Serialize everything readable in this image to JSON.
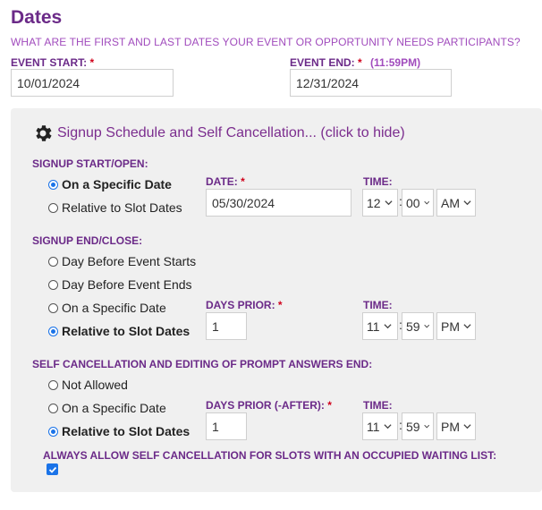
{
  "header": {
    "title": "Dates",
    "question": "WHAT ARE THE FIRST AND LAST DATES YOUR EVENT OR OPPORTUNITY NEEDS PARTICIPANTS?"
  },
  "event_start": {
    "label": "EVENT START:",
    "required": "*",
    "value": "10/01/2024"
  },
  "event_end": {
    "label": "EVENT END:",
    "required": "*",
    "hint": "(11:59PM)",
    "value": "12/31/2024"
  },
  "panel": {
    "title": "Signup Schedule and Self Cancellation... (click to hide)",
    "signup_start": {
      "heading": "SIGNUP START/OPEN:",
      "options": [
        "On a Specific Date",
        "Relative to Slot Dates"
      ],
      "selected": "On a Specific Date",
      "date_label": "DATE:",
      "date_required": "*",
      "date_value": "05/30/2024",
      "time_label": "TIME:",
      "hour": "12",
      "minute": "00",
      "ampm": "AM"
    },
    "signup_end": {
      "heading": "SIGNUP END/CLOSE:",
      "options": [
        "Day Before Event Starts",
        "Day Before Event Ends",
        "On a Specific Date",
        "Relative to Slot Dates"
      ],
      "selected": "Relative to Slot Dates",
      "days_label": "DAYS PRIOR:",
      "days_required": "*",
      "days_value": "1",
      "time_label": "TIME:",
      "hour": "11",
      "minute": "59",
      "ampm": "PM"
    },
    "self_cancel": {
      "heading": "SELF CANCELLATION AND EDITING OF PROMPT ANSWERS END:",
      "options": [
        "Not Allowed",
        "On a Specific Date",
        "Relative to Slot Dates"
      ],
      "selected": "Relative to Slot Dates",
      "days_label": "DAYS PRIOR (-AFTER):",
      "days_required": "*",
      "days_value": "1",
      "time_label": "TIME:",
      "hour": "11",
      "minute": "59",
      "ampm": "PM"
    },
    "waiting_list": {
      "label": "ALWAYS ALLOW SELF CANCELLATION FOR SLOTS WITH AN OCCUPIED WAITING LIST:",
      "checked": true
    }
  },
  "colors": {
    "brand_purple": "#6b2a88",
    "accent_purple": "#a14cbd",
    "required_red": "#d0021b",
    "checkbox_blue": "#1a73e8"
  },
  "icons": {
    "panel_toggle": "gear-icon",
    "select_arrow": "chevron-down-icon"
  }
}
